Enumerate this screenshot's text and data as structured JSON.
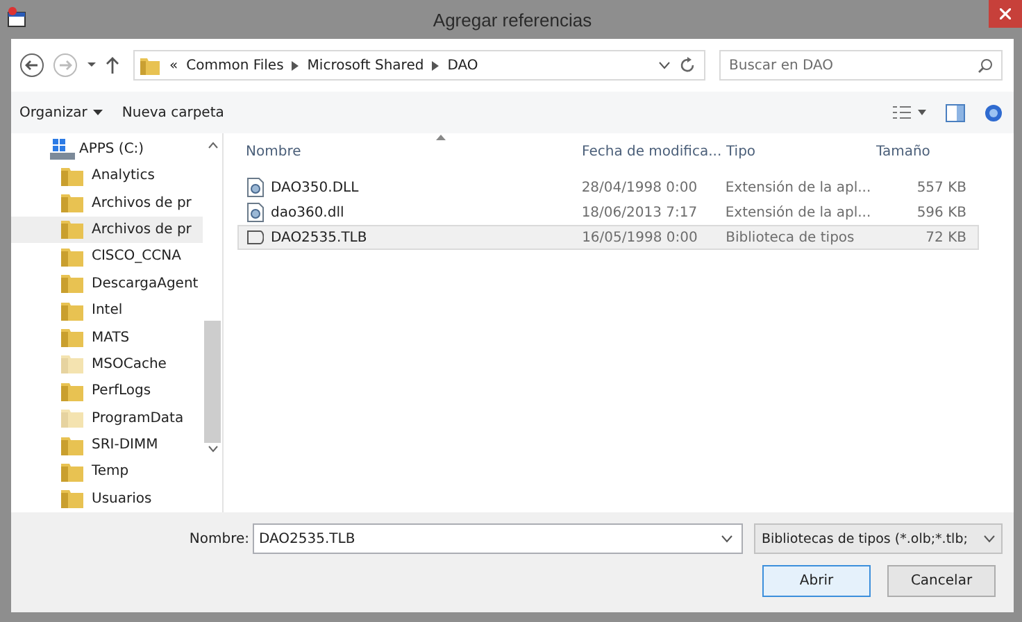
{
  "window": {
    "title": "Agregar referencias"
  },
  "address": {
    "overflow": "«",
    "crumbs": [
      "Common Files",
      "Microsoft Shared",
      "DAO"
    ]
  },
  "search": {
    "placeholder": "Buscar en DAO"
  },
  "toolbar": {
    "organize": "Organizar",
    "new_folder": "Nueva carpeta"
  },
  "tree": [
    {
      "label": "APPS (C:)",
      "children": [
        {
          "label": "Analytics",
          "selected": false,
          "hidden": false
        },
        {
          "label": "Archivos de pr",
          "selected": false,
          "hidden": false
        },
        {
          "label": "Archivos de pr",
          "selected": true,
          "hidden": false
        },
        {
          "label": "CISCO_CCNA",
          "selected": false,
          "hidden": false
        },
        {
          "label": "DescargaAgent",
          "selected": false,
          "hidden": false
        },
        {
          "label": "Intel",
          "selected": false,
          "hidden": false
        },
        {
          "label": "MATS",
          "selected": false,
          "hidden": false
        },
        {
          "label": "MSOCache",
          "selected": false,
          "hidden": true
        },
        {
          "label": "PerfLogs",
          "selected": false,
          "hidden": false
        },
        {
          "label": "ProgramData",
          "selected": false,
          "hidden": true
        },
        {
          "label": "SRI-DIMM",
          "selected": false,
          "hidden": false
        },
        {
          "label": "Temp",
          "selected": false,
          "hidden": false
        },
        {
          "label": "Usuarios",
          "selected": false,
          "hidden": false
        }
      ]
    }
  ],
  "table": {
    "columns": [
      "Nombre",
      "Fecha de modifica...",
      "Tipo",
      "Tamaño"
    ],
    "rows": [
      {
        "kind": "dll",
        "name": "DAO350.DLL",
        "date": "28/04/1998 0:00",
        "type": "Extensión de la apl...",
        "size": "557 KB",
        "selected": false
      },
      {
        "kind": "dll",
        "name": "dao360.dll",
        "date": "18/06/2013 7:17",
        "type": "Extensión de la apl...",
        "size": "596 KB",
        "selected": false
      },
      {
        "kind": "tlb",
        "name": "DAO2535.TLB",
        "date": "16/05/1998 0:00",
        "type": "Biblioteca de tipos",
        "size": "72 KB",
        "selected": true
      }
    ]
  },
  "filename": {
    "label": "Nombre:",
    "value": "DAO2535.TLB"
  },
  "filter": {
    "value": "Bibliotecas de tipos (*.olb;*.tlb;"
  },
  "buttons": [
    "Abrir",
    "Cancelar"
  ]
}
